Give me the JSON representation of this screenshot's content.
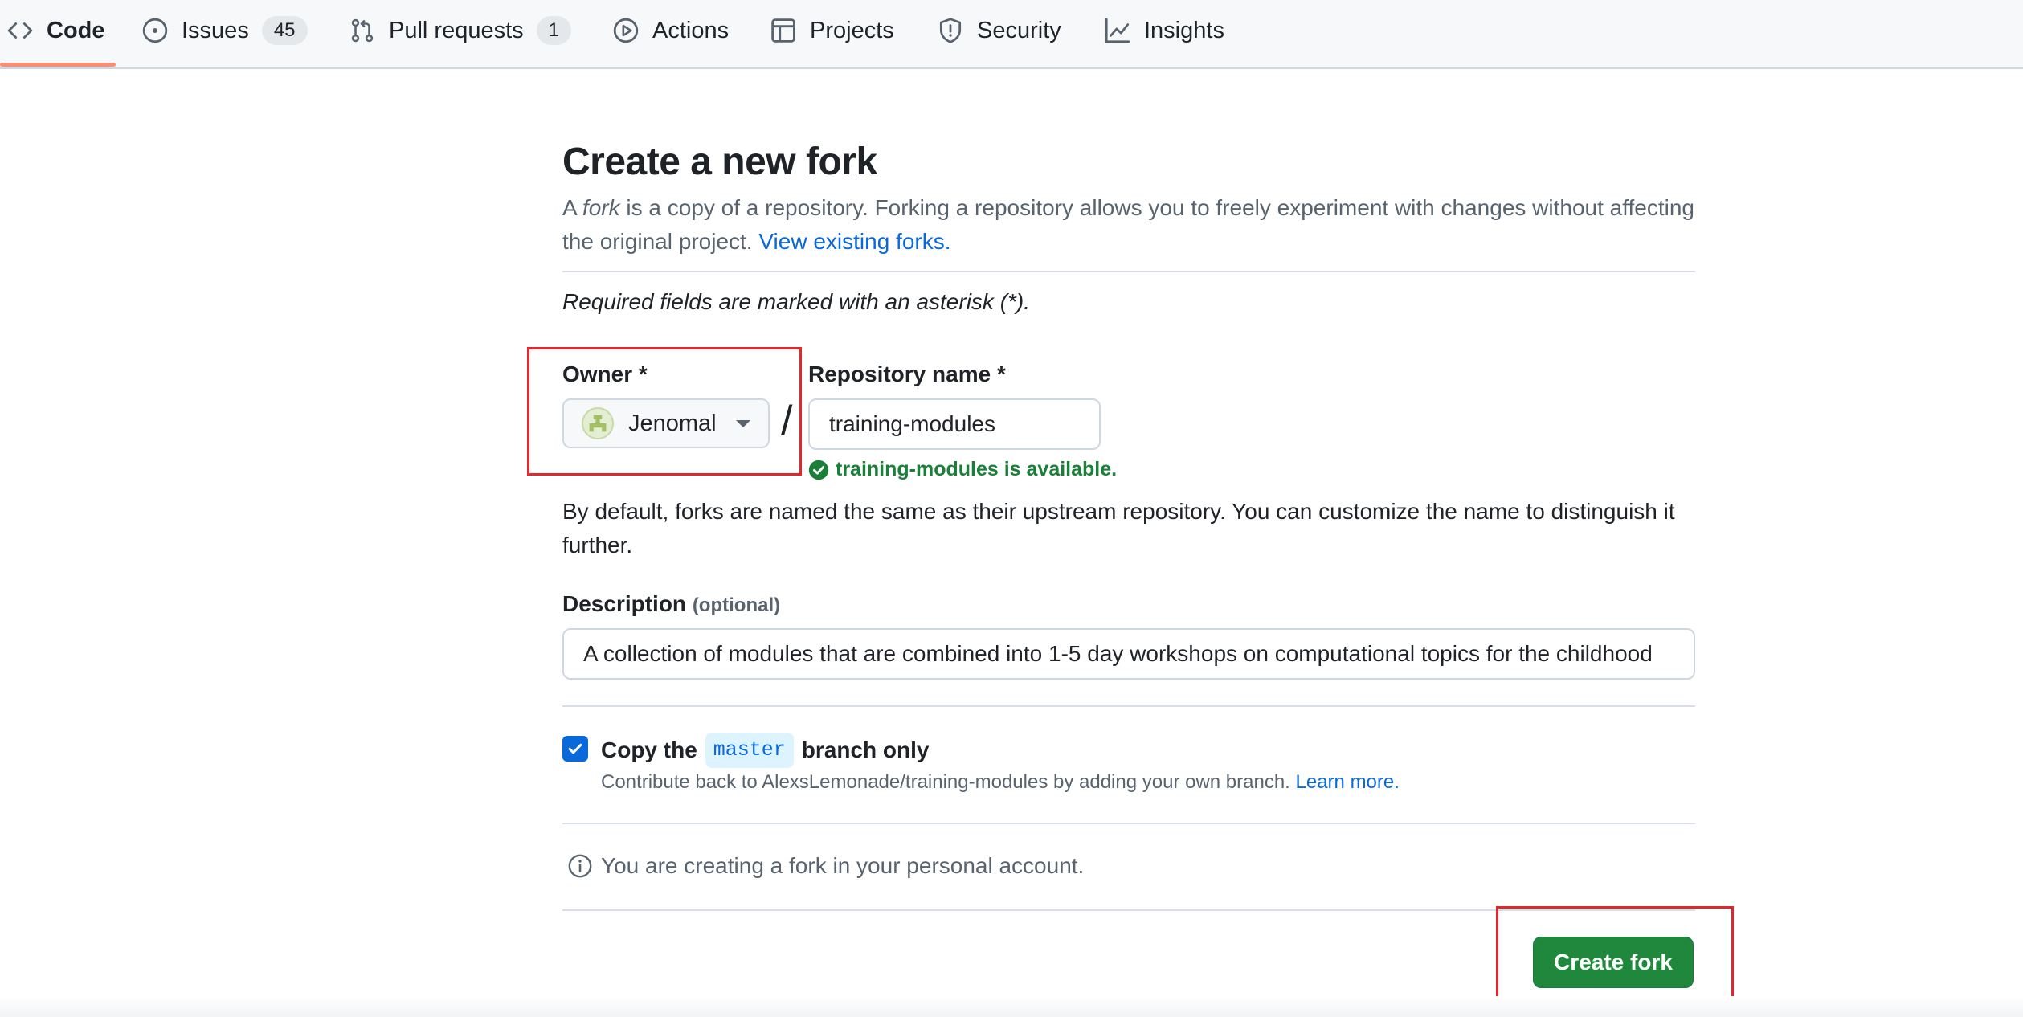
{
  "nav": {
    "items": [
      {
        "label": "Code",
        "icon": "code-icon",
        "selected": true
      },
      {
        "label": "Issues",
        "icon": "issue-opened-icon",
        "count": "45"
      },
      {
        "label": "Pull requests",
        "icon": "git-pull-request-icon",
        "count": "1"
      },
      {
        "label": "Actions",
        "icon": "play-icon"
      },
      {
        "label": "Projects",
        "icon": "table-icon"
      },
      {
        "label": "Security",
        "icon": "shield-icon"
      },
      {
        "label": "Insights",
        "icon": "graph-icon"
      }
    ]
  },
  "form": {
    "title": "Create a new fork",
    "intro_prefix": "A ",
    "intro_em": "fork",
    "intro_rest": " is a copy of a repository. Forking a repository allows you to freely experiment with changes without affecting the original project. ",
    "view_forks_link": "View existing forks.",
    "required_note": "Required fields are marked with an asterisk (*).",
    "owner_label": "Owner *",
    "owner_value": "Jenomal",
    "separator": "/",
    "repo_label": "Repository name *",
    "repo_value": "training-modules",
    "availability": "training-modules is available.",
    "default_help": "By default, forks are named the same as their upstream repository. You can customize the name to distinguish it further.",
    "description_label": "Description",
    "description_optional": "(optional)",
    "description_value": "A collection of modules that are combined into 1-5 day workshops on computational topics for the childhood",
    "copy_prefix": "Copy the",
    "copy_branch": "master",
    "copy_suffix": "branch only",
    "copy_checked": true,
    "copy_sub": "Contribute back to AlexsLemonade/training-modules by adding your own branch. ",
    "learn_more": "Learn more.",
    "info_text": "You are creating a fork in your personal account.",
    "create_button": "Create fork"
  },
  "colors": {
    "accent": "#0969da",
    "success": "#1a7f37",
    "primary_button": "#1f883d",
    "nav_underline": "#fd8c73",
    "annotation": "#e5262a"
  }
}
